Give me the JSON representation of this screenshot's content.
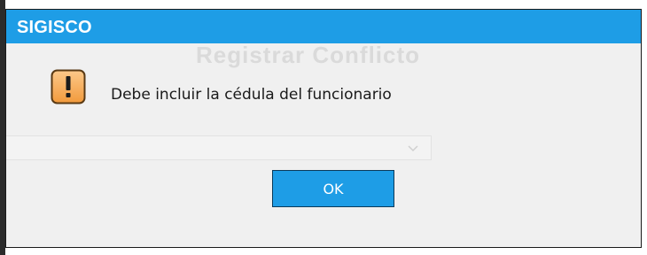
{
  "dialog": {
    "title": "SIGISCO",
    "message": "Debe incluir la cédula del funcionario",
    "ok_label": "OK",
    "icon": "warning-icon"
  },
  "background": {
    "heading": "Registrar Conflicto"
  },
  "colors": {
    "accent": "#1e9de6",
    "dialog_bg": "#f0f0f0",
    "warning_icon_fill": "#f7a64a"
  }
}
